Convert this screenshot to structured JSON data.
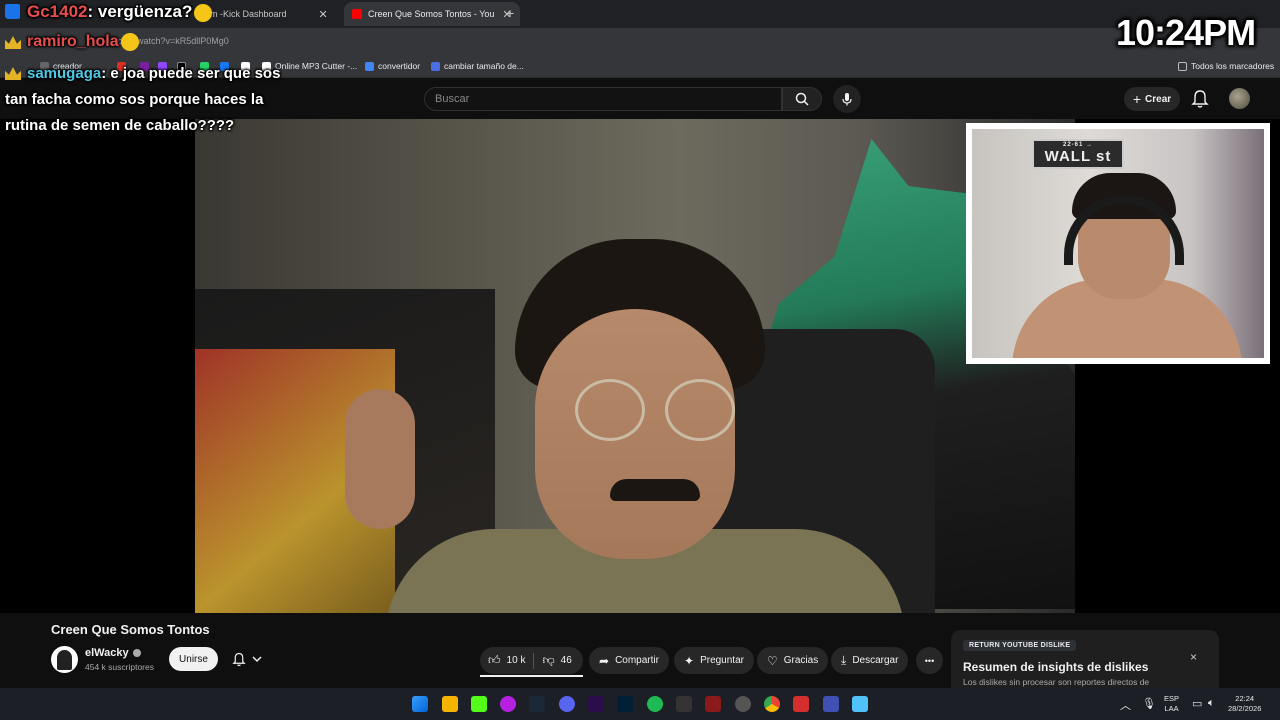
{
  "browser": {
    "tabs": [
      {
        "label": "Kick Dashboard",
        "partial_prefix": "m - ",
        "favicon_color": "#53fc18"
      },
      {
        "label": "Creen Que Somos Tontos - You",
        "favicon_color": "#ff0000"
      }
    ],
    "new_tab_label": "+",
    "url": "e.com/watch?v=kR5dllP0Mg0",
    "bookmarks": [
      {
        "label": "creador",
        "color": "#888888"
      },
      {
        "label": "Online MP3 Cutter -...",
        "color": "#ffffff"
      },
      {
        "label": "convertidor",
        "color": "#4285f4"
      },
      {
        "label": "cambiar tamaño de...",
        "color": "#4a6fe3"
      }
    ],
    "all_bookmarks_label": "Todos los marcadores"
  },
  "youtube": {
    "search_placeholder": "Buscar",
    "create_label": "Crear",
    "video": {
      "title": "Creen Que Somos Tontos",
      "channel": "elWacky",
      "subscribers": "454 k suscriptores",
      "join_label": "Unirse",
      "likes": "10 k",
      "dislikes": "46",
      "share_label": "Compartir",
      "ask_label": "Preguntar",
      "thanks_label": "Gracias",
      "download_label": "Descargar",
      "more_label": "•••"
    },
    "extension_card": {
      "tag": "RETURN YOUTUBE DISLIKE",
      "title": "Resumen de insights de dislikes",
      "subtitle": "Los dislikes sin procesar son reportes directos de",
      "close_label": "×"
    }
  },
  "overlay": {
    "clock": "10:24PM",
    "webcam_sign_top": "22-61 →",
    "webcam_sign": "WALL st",
    "chat": [
      {
        "user": "Gc1402",
        "message": ": vergüenza?"
      },
      {
        "user": "ramiro_hola",
        "message": ""
      },
      {
        "user": "samugaga",
        "message": ": e joa puede ser que sos"
      },
      {
        "user": "",
        "message": "tan facha como sos porque haces la"
      },
      {
        "user": "",
        "message": "rutina de semen de caballo????"
      }
    ]
  },
  "taskbar": {
    "language": "ESP",
    "layout": "LAA",
    "time": "22:24",
    "date": "28/2/2026"
  },
  "colors": {
    "youtube_bg": "#0f0f0f",
    "accent_red": "#ff0000",
    "chat_username": "#e84e4e",
    "chat_username_alt": "#4ec9e8"
  }
}
